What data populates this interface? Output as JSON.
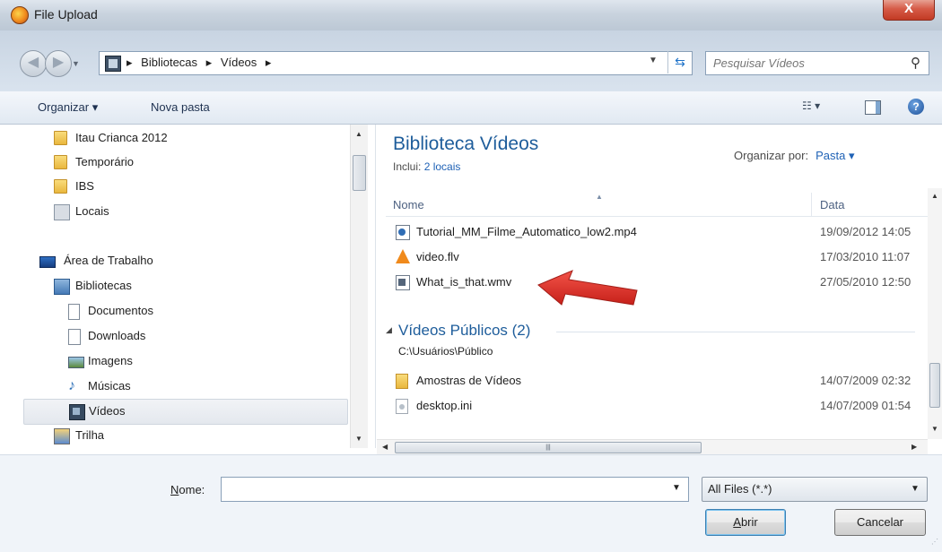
{
  "window": {
    "title": "File Upload",
    "close_label": "X"
  },
  "address": {
    "crumbs": [
      "Bibliotecas",
      "Vídeos"
    ],
    "separator": "▸",
    "search_placeholder": "Pesquisar Vídeos"
  },
  "toolbar": {
    "organize_label": "Organizar ▾",
    "new_folder_label": "Nova pasta",
    "help_label": "?"
  },
  "navpane": {
    "items": [
      {
        "label": "Itau Crianca 2012",
        "icon": "folder-icon"
      },
      {
        "label": "Temporário",
        "icon": "folder-icon"
      },
      {
        "label": "IBS",
        "icon": "folder-icon"
      },
      {
        "label": "Locais",
        "icon": "drive-icon"
      },
      {
        "label": "Área de Trabalho",
        "icon": "desktop-icon"
      },
      {
        "label": "Bibliotecas",
        "icon": "library-icon"
      },
      {
        "label": "Documentos",
        "icon": "documents-icon"
      },
      {
        "label": "Downloads",
        "icon": "downloads-icon"
      },
      {
        "label": "Imagens",
        "icon": "pictures-icon"
      },
      {
        "label": "Músicas",
        "icon": "music-icon"
      },
      {
        "label": "Vídeos",
        "icon": "videos-icon",
        "selected": true
      },
      {
        "label": "Trilha",
        "icon": "trail-icon"
      }
    ]
  },
  "library": {
    "title": "Biblioteca Vídeos",
    "includes_label": "Inclui:",
    "includes_link": "2 locais",
    "arrange_label": "Organizar por:",
    "arrange_value": "Pasta ▾"
  },
  "columns": {
    "name": "Nome",
    "date": "Data"
  },
  "files": [
    {
      "name": "Tutorial_MM_Filme_Automatico_low2.mp4",
      "date": "19/09/2012 14:05",
      "icon": "mp4-file-icon"
    },
    {
      "name": "video.flv",
      "date": "17/03/2010 11:07",
      "icon": "vlc-file-icon"
    },
    {
      "name": "What_is_that.wmv",
      "date": "27/05/2010 12:50",
      "icon": "wmv-file-icon"
    }
  ],
  "public_group": {
    "name": "Vídeos Públicos (2)",
    "path": "C:\\Usuários\\Público",
    "files": [
      {
        "name": "Amostras de Vídeos",
        "date": "14/07/2009 02:32",
        "icon": "folder-icon"
      },
      {
        "name": "desktop.ini",
        "date": "14/07/2009 01:54",
        "icon": "settings-file-icon"
      }
    ]
  },
  "bottom": {
    "filename_label_u": "N",
    "filename_label_rest": "ome:",
    "filename_value": "",
    "filetype_value": "All Files (*.*)",
    "open_u": "A",
    "open_rest": "brir",
    "cancel_label": "Cancelar"
  },
  "colors": {
    "accent": "#1e5d9b",
    "link": "#1f62b6",
    "annotation_arrow": "#e0261c"
  }
}
